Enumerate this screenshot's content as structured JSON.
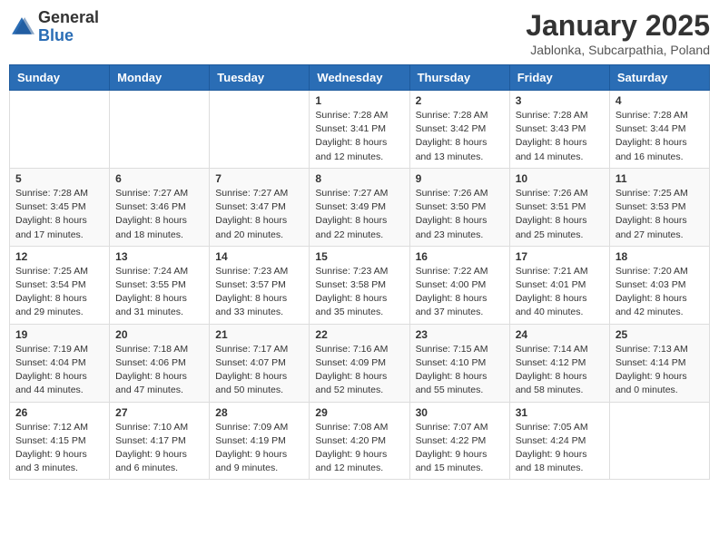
{
  "header": {
    "logo_general": "General",
    "logo_blue": "Blue",
    "title": "January 2025",
    "subtitle": "Jablonka, Subcarpathia, Poland"
  },
  "days_of_week": [
    "Sunday",
    "Monday",
    "Tuesday",
    "Wednesday",
    "Thursday",
    "Friday",
    "Saturday"
  ],
  "weeks": [
    [
      {
        "day": "",
        "info": ""
      },
      {
        "day": "",
        "info": ""
      },
      {
        "day": "",
        "info": ""
      },
      {
        "day": "1",
        "info": "Sunrise: 7:28 AM\nSunset: 3:41 PM\nDaylight: 8 hours\nand 12 minutes."
      },
      {
        "day": "2",
        "info": "Sunrise: 7:28 AM\nSunset: 3:42 PM\nDaylight: 8 hours\nand 13 minutes."
      },
      {
        "day": "3",
        "info": "Sunrise: 7:28 AM\nSunset: 3:43 PM\nDaylight: 8 hours\nand 14 minutes."
      },
      {
        "day": "4",
        "info": "Sunrise: 7:28 AM\nSunset: 3:44 PM\nDaylight: 8 hours\nand 16 minutes."
      }
    ],
    [
      {
        "day": "5",
        "info": "Sunrise: 7:28 AM\nSunset: 3:45 PM\nDaylight: 8 hours\nand 17 minutes."
      },
      {
        "day": "6",
        "info": "Sunrise: 7:27 AM\nSunset: 3:46 PM\nDaylight: 8 hours\nand 18 minutes."
      },
      {
        "day": "7",
        "info": "Sunrise: 7:27 AM\nSunset: 3:47 PM\nDaylight: 8 hours\nand 20 minutes."
      },
      {
        "day": "8",
        "info": "Sunrise: 7:27 AM\nSunset: 3:49 PM\nDaylight: 8 hours\nand 22 minutes."
      },
      {
        "day": "9",
        "info": "Sunrise: 7:26 AM\nSunset: 3:50 PM\nDaylight: 8 hours\nand 23 minutes."
      },
      {
        "day": "10",
        "info": "Sunrise: 7:26 AM\nSunset: 3:51 PM\nDaylight: 8 hours\nand 25 minutes."
      },
      {
        "day": "11",
        "info": "Sunrise: 7:25 AM\nSunset: 3:53 PM\nDaylight: 8 hours\nand 27 minutes."
      }
    ],
    [
      {
        "day": "12",
        "info": "Sunrise: 7:25 AM\nSunset: 3:54 PM\nDaylight: 8 hours\nand 29 minutes."
      },
      {
        "day": "13",
        "info": "Sunrise: 7:24 AM\nSunset: 3:55 PM\nDaylight: 8 hours\nand 31 minutes."
      },
      {
        "day": "14",
        "info": "Sunrise: 7:23 AM\nSunset: 3:57 PM\nDaylight: 8 hours\nand 33 minutes."
      },
      {
        "day": "15",
        "info": "Sunrise: 7:23 AM\nSunset: 3:58 PM\nDaylight: 8 hours\nand 35 minutes."
      },
      {
        "day": "16",
        "info": "Sunrise: 7:22 AM\nSunset: 4:00 PM\nDaylight: 8 hours\nand 37 minutes."
      },
      {
        "day": "17",
        "info": "Sunrise: 7:21 AM\nSunset: 4:01 PM\nDaylight: 8 hours\nand 40 minutes."
      },
      {
        "day": "18",
        "info": "Sunrise: 7:20 AM\nSunset: 4:03 PM\nDaylight: 8 hours\nand 42 minutes."
      }
    ],
    [
      {
        "day": "19",
        "info": "Sunrise: 7:19 AM\nSunset: 4:04 PM\nDaylight: 8 hours\nand 44 minutes."
      },
      {
        "day": "20",
        "info": "Sunrise: 7:18 AM\nSunset: 4:06 PM\nDaylight: 8 hours\nand 47 minutes."
      },
      {
        "day": "21",
        "info": "Sunrise: 7:17 AM\nSunset: 4:07 PM\nDaylight: 8 hours\nand 50 minutes."
      },
      {
        "day": "22",
        "info": "Sunrise: 7:16 AM\nSunset: 4:09 PM\nDaylight: 8 hours\nand 52 minutes."
      },
      {
        "day": "23",
        "info": "Sunrise: 7:15 AM\nSunset: 4:10 PM\nDaylight: 8 hours\nand 55 minutes."
      },
      {
        "day": "24",
        "info": "Sunrise: 7:14 AM\nSunset: 4:12 PM\nDaylight: 8 hours\nand 58 minutes."
      },
      {
        "day": "25",
        "info": "Sunrise: 7:13 AM\nSunset: 4:14 PM\nDaylight: 9 hours\nand 0 minutes."
      }
    ],
    [
      {
        "day": "26",
        "info": "Sunrise: 7:12 AM\nSunset: 4:15 PM\nDaylight: 9 hours\nand 3 minutes."
      },
      {
        "day": "27",
        "info": "Sunrise: 7:10 AM\nSunset: 4:17 PM\nDaylight: 9 hours\nand 6 minutes."
      },
      {
        "day": "28",
        "info": "Sunrise: 7:09 AM\nSunset: 4:19 PM\nDaylight: 9 hours\nand 9 minutes."
      },
      {
        "day": "29",
        "info": "Sunrise: 7:08 AM\nSunset: 4:20 PM\nDaylight: 9 hours\nand 12 minutes."
      },
      {
        "day": "30",
        "info": "Sunrise: 7:07 AM\nSunset: 4:22 PM\nDaylight: 9 hours\nand 15 minutes."
      },
      {
        "day": "31",
        "info": "Sunrise: 7:05 AM\nSunset: 4:24 PM\nDaylight: 9 hours\nand 18 minutes."
      },
      {
        "day": "",
        "info": ""
      }
    ]
  ]
}
